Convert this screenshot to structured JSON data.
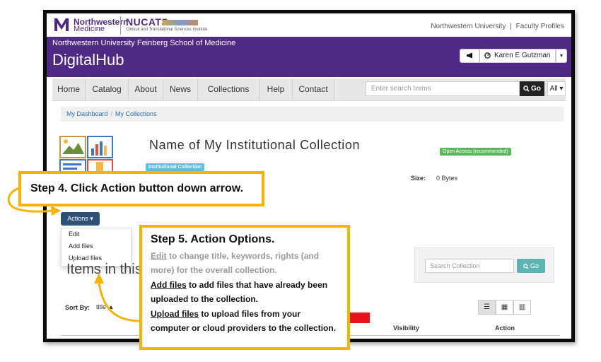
{
  "topbar": {
    "logo_primary": "Northwestern",
    "logo_secondary": "Medicine",
    "nucats": "NUCATS",
    "nucats_sub": "Clinical and Translational Sciences Institute",
    "link_university": "Northwestern University",
    "link_sep": "|",
    "link_profiles": "Faculty Profiles"
  },
  "header": {
    "school": "Northwestern University Feinberg School of Medicine",
    "title": "DigitalHub",
    "user_name": "Karen E Gutzman"
  },
  "nav": {
    "items": [
      "Home",
      "Catalog",
      "About",
      "News",
      "Collections",
      "Help",
      "Contact"
    ],
    "search_placeholder": "Enter search terms",
    "go_label": "Go",
    "scope_label": "All"
  },
  "breadcrumb": {
    "items": [
      "My Dashboard",
      "My Collections"
    ],
    "sep": "/"
  },
  "collection": {
    "title": "Name of My Institutional Collection",
    "type_badge": "Institutional Collection",
    "access_badge": "Open Access (recommended)",
    "size_label": "Size:",
    "size_value": "0 Bytes",
    "items_heading": "Items in this"
  },
  "actions": {
    "button_label": "Actions",
    "menu": [
      "Edit",
      "Add files",
      "Upload files"
    ]
  },
  "search_collection": {
    "placeholder": "Search Collection",
    "go_label": "Go"
  },
  "table": {
    "sort_label": "Sort By:",
    "sort_value": "title ▲",
    "columns": [
      "Visibility",
      "Action"
    ]
  },
  "callout4": {
    "text": "Step 4. Click Action button down arrow."
  },
  "callout5": {
    "title": "Step 5. Action Options.",
    "edit_link": "Edit",
    "edit_text": " to change title, keywords, rights (and more) for the overall collection.",
    "add_link": "Add files",
    "add_text": " to add files that have already been uploaded to the collection.",
    "upload_link": "Upload files",
    "upload_text": " to upload files from your computer or cloud providers to the collection."
  },
  "colors": {
    "purple": "#4e2a84",
    "callout_border": "#f6b400",
    "red_arrow": "#e8141b",
    "actions_button": "#2c5077",
    "teal_go": "#5bb5b0"
  }
}
